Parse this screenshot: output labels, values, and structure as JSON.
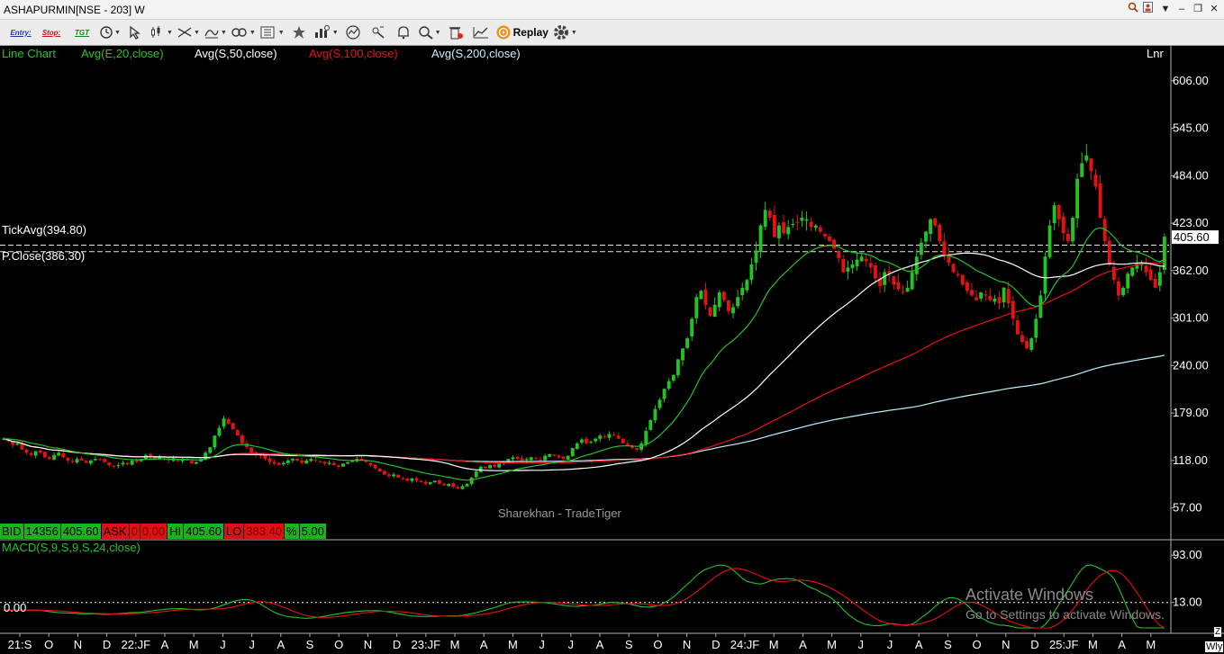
{
  "window": {
    "title": "ASHAPURMIN[NSE - 203] W"
  },
  "toolbar": {
    "entry_label": "Entry:",
    "stop_label": "Stop:",
    "tgt_label": "TGT",
    "replay_label": "Replay"
  },
  "legend": {
    "chart_type": "Line Chart",
    "ema20": "Avg(E,20,close)",
    "sma50": "Avg(S,50,close)",
    "sma100": "Avg(S,100,close)",
    "sma200": "Avg(S,200,close)",
    "scale": "Lnr"
  },
  "overlays": {
    "tick_avg": "TickAvg(394.80)",
    "prev_close": "P.Close(386.30)",
    "last_price": "405.60"
  },
  "quote": {
    "bid_label": "BID",
    "bid_qty": "14356",
    "bid_price": "405.60",
    "ask_label": "ASK",
    "ask_qty": "0",
    "ask_price": "0.00",
    "hi_label": "HI",
    "hi": "405.60",
    "lo_label": "LO",
    "lo": "383.40",
    "pct_label": "%",
    "pct": "5.00"
  },
  "watermark": "Sharekhan - TradeTiger",
  "macd": {
    "title": "MACD(S,9,S,9,S,24,close)",
    "zero_label": "0.00"
  },
  "activate": {
    "line1": "Activate Windows",
    "line2": "Go to Settings to activate Windows."
  },
  "corner": {
    "wk": "Wly",
    "z": "Z"
  },
  "colors": {
    "up": "#22c322",
    "down": "#e81010",
    "ema20": "#22c322",
    "sma50": "#ffffff",
    "sma100": "#e81010",
    "sma200": "#bff3ff",
    "background": "#000000"
  },
  "chart_data": [
    {
      "type": "candlestick",
      "ylim": [
        30,
        630
      ],
      "y_ticks": [
        "606.00",
        "545.00",
        "484.00",
        "423.00",
        "362.00",
        "301.00",
        "240.00",
        "179.00",
        "118.00",
        "57.00"
      ],
      "x_ticks": [
        "21:S",
        "O",
        "N",
        "D",
        "22:JF",
        "A",
        "M",
        "J",
        "J",
        "A",
        "S",
        "O",
        "N",
        "D",
        "23:JF",
        "M",
        "A",
        "M",
        "J",
        "J",
        "A",
        "S",
        "O",
        "N",
        "D",
        "24:JF",
        "M",
        "A",
        "M",
        "J",
        "J",
        "A",
        "S",
        "O",
        "N",
        "D",
        "25:JF",
        "M",
        "A",
        "M"
      ],
      "reference_lines": [
        {
          "label": "TickAvg",
          "value": 394.8
        },
        {
          "label": "P.Close",
          "value": 386.3
        }
      ],
      "last": 405.6,
      "close": [
        146,
        143,
        138,
        140,
        132,
        128,
        125,
        130,
        128,
        122,
        120,
        125,
        128,
        122,
        118,
        116,
        120,
        118,
        115,
        118,
        120,
        119,
        116,
        112,
        110,
        112,
        115,
        113,
        118,
        116,
        120,
        125,
        122,
        119,
        122,
        120,
        118,
        121,
        117,
        120,
        118,
        114,
        116,
        120,
        128,
        135,
        150,
        160,
        172,
        165,
        158,
        150,
        140,
        135,
        128,
        125,
        124,
        120,
        116,
        114,
        112,
        115,
        118,
        120,
        118,
        115,
        118,
        120,
        118,
        116,
        114,
        115,
        112,
        110,
        114,
        116,
        118,
        120,
        118,
        116,
        112,
        108,
        104,
        100,
        98,
        100,
        96,
        94,
        92,
        95,
        92,
        90,
        88,
        90,
        92,
        88,
        86,
        88,
        84,
        82,
        85,
        88,
        96,
        104,
        110,
        108,
        112,
        110,
        114,
        116,
        120,
        122,
        120,
        118,
        120,
        122,
        120,
        119,
        124,
        126,
        124,
        122,
        120,
        124,
        134,
        140,
        145,
        140,
        142,
        146,
        150,
        148,
        152,
        150,
        146,
        140,
        138,
        134,
        132,
        140,
        156,
        170,
        184,
        196,
        210,
        220,
        228,
        248,
        262,
        275,
        300,
        328,
        336,
        318,
        304,
        318,
        334,
        324,
        310,
        315,
        328,
        340,
        350,
        370,
        388,
        420,
        440,
        430,
        405,
        420,
        410,
        418,
        422,
        424,
        430,
        428,
        418,
        420,
        412,
        406,
        400,
        390,
        378,
        360,
        366,
        370,
        376,
        380,
        374,
        366,
        352,
        342,
        360,
        358,
        344,
        338,
        334,
        340,
        360,
        380,
        398,
        412,
        428,
        420,
        400,
        382,
        372,
        360,
        356,
        344,
        336,
        330,
        324,
        334,
        330,
        324,
        326,
        320,
        340,
        320,
        300,
        280,
        270,
        262,
        275,
        300,
        330,
        380,
        420,
        446,
        428,
        410,
        400,
        430,
        480,
        500,
        510,
        490,
        470,
        430,
        400,
        370,
        350,
        330,
        340,
        358,
        366,
        372,
        370,
        360,
        350,
        340,
        360,
        405.6
      ]
    },
    {
      "type": "line",
      "name": "MACD(S,9,S,9,S,24,close)",
      "ylim": [
        -30,
        110
      ],
      "y_ticks": [
        "93.00",
        "13.00"
      ],
      "zero_label": "0.00"
    }
  ]
}
